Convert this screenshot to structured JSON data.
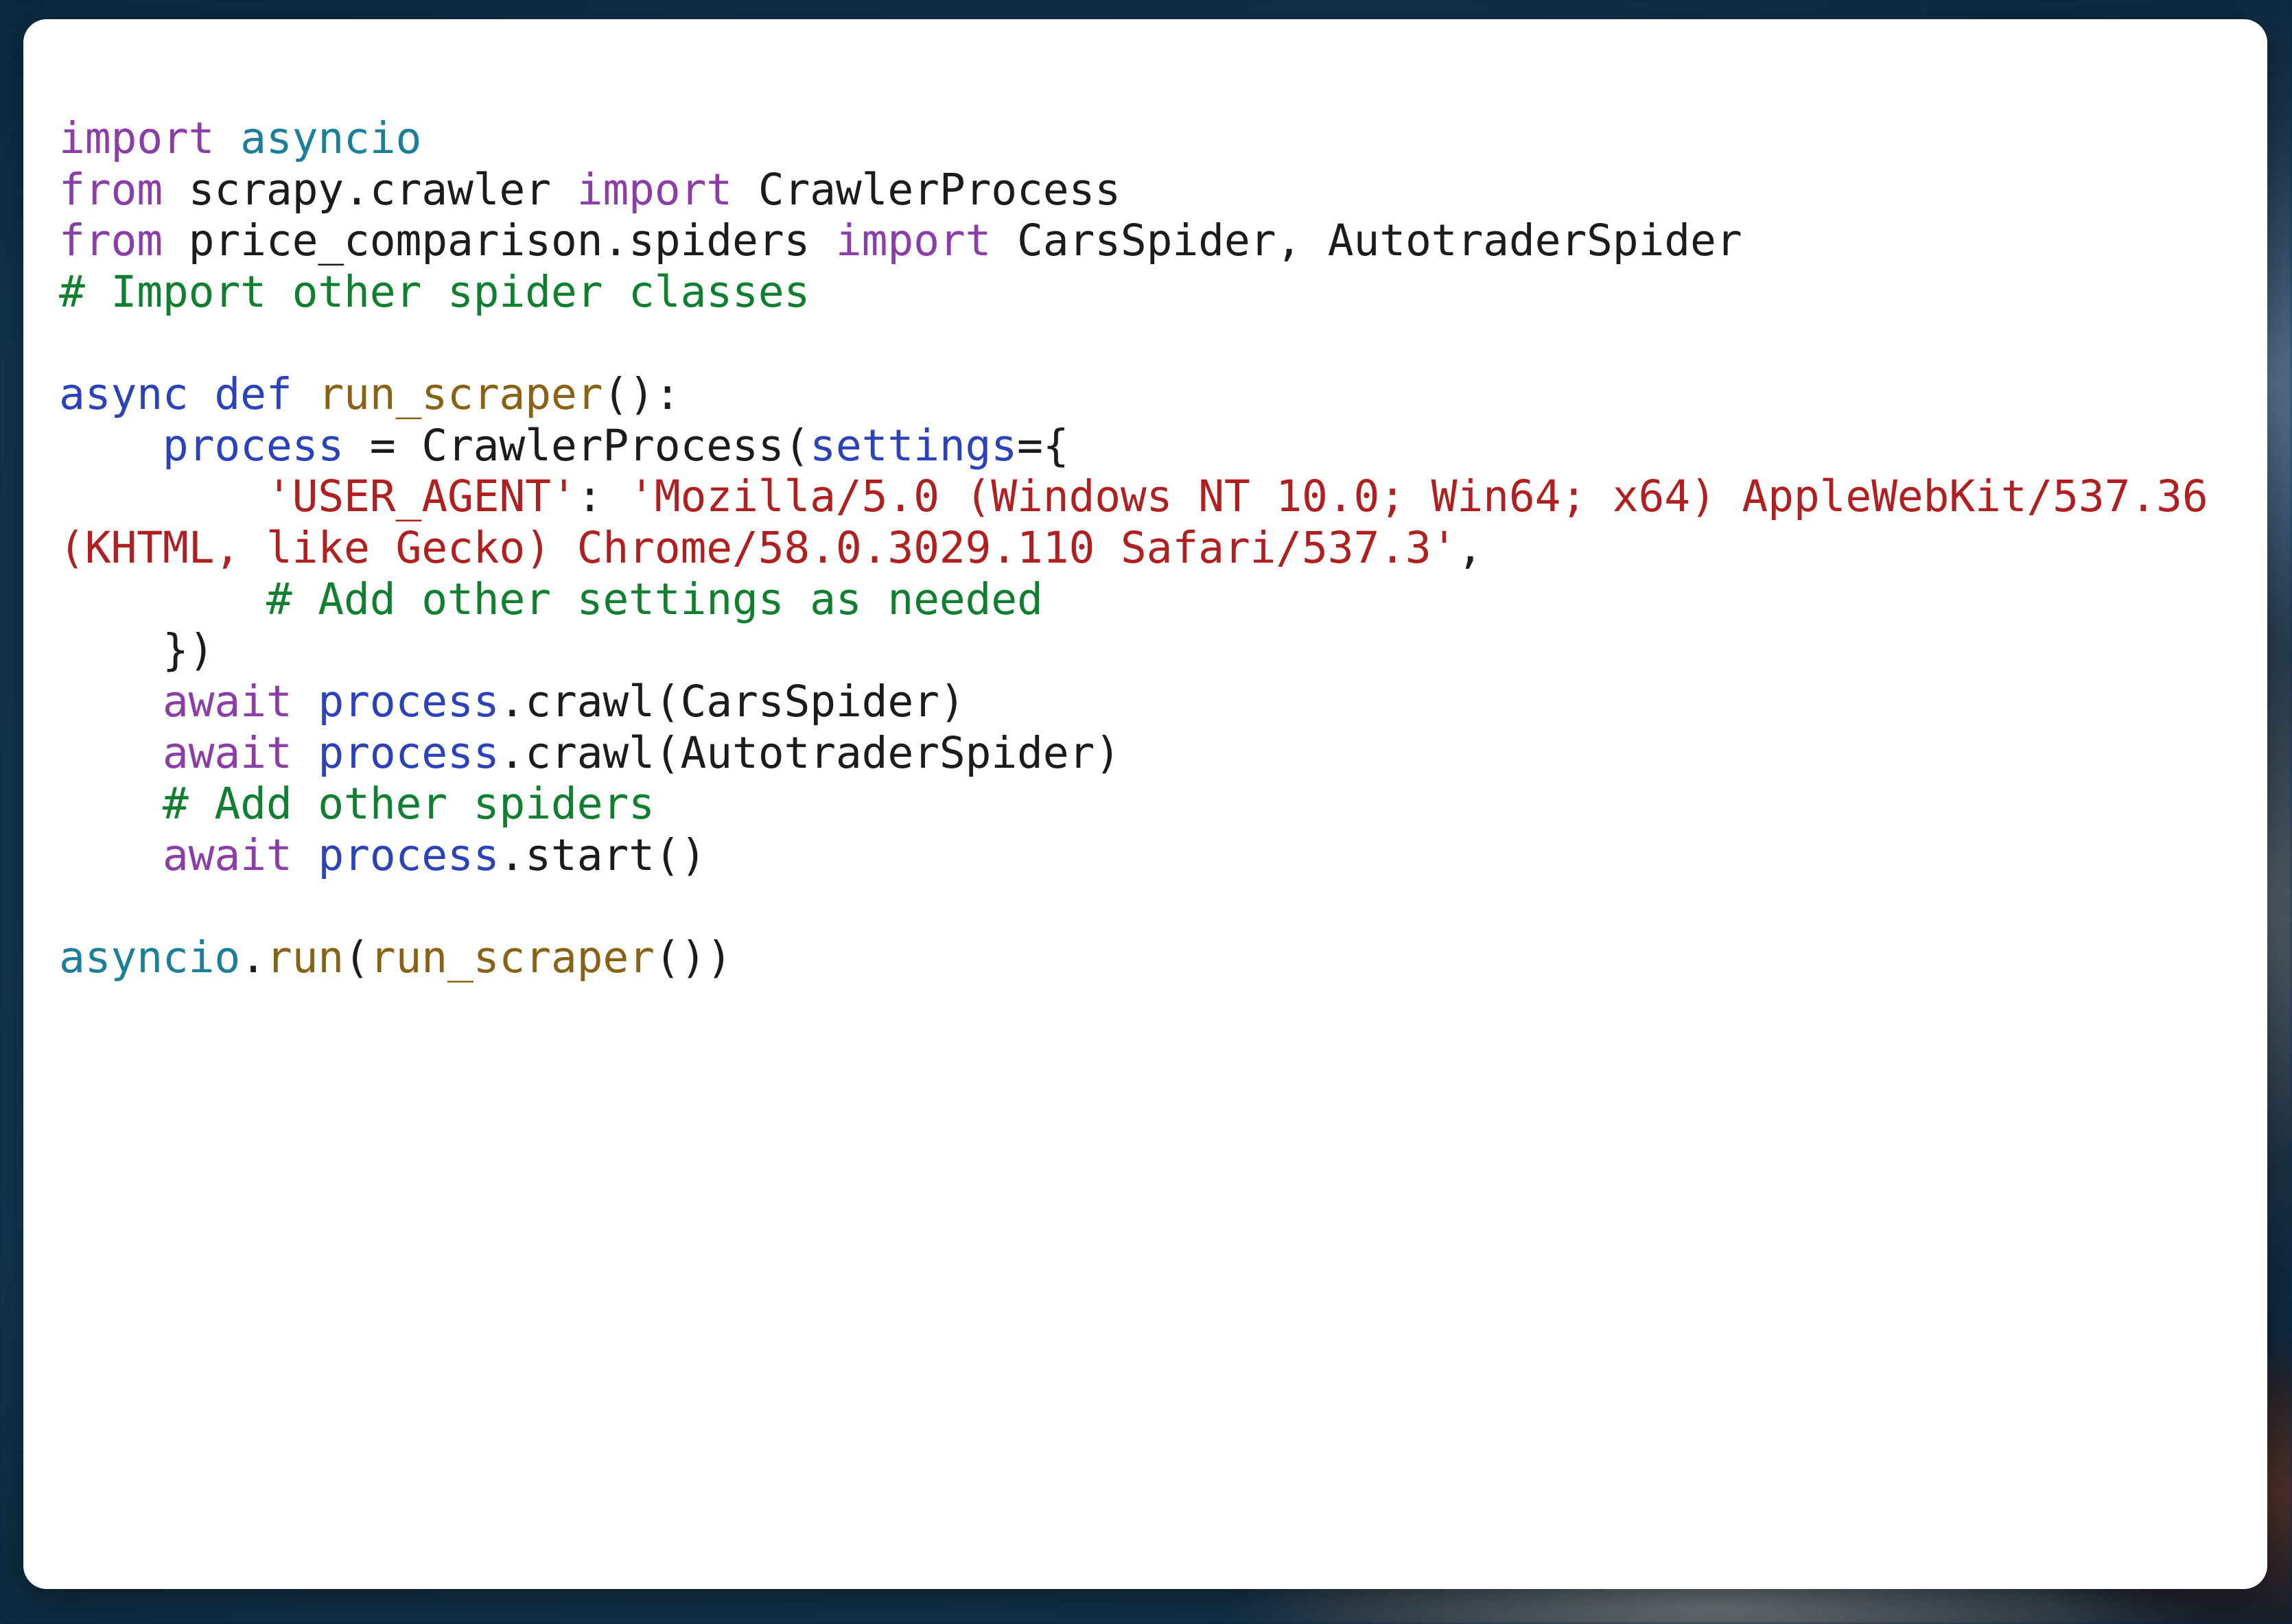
{
  "theme": {
    "page_background": "#0e3050",
    "card_background": "#ffffff",
    "keyword_color": "#8b3da8",
    "keyword_alt_color": "#2c42b8",
    "module_color": "#1b7f99",
    "function_color": "#8a6216",
    "variable_color": "#2c42b8",
    "string_color": "#b02020",
    "comment_color": "#108030",
    "plain_color": "#1c1c1c"
  },
  "code": {
    "language": "python",
    "lines": [
      {
        "id": "l01",
        "tokens": [
          {
            "t": "import",
            "c": "kw"
          },
          {
            "t": " ",
            "c": "pln"
          },
          {
            "t": "asyncio",
            "c": "mod"
          }
        ]
      },
      {
        "id": "l02",
        "tokens": [
          {
            "t": "from",
            "c": "kw"
          },
          {
            "t": " scrapy.crawler ",
            "c": "pln"
          },
          {
            "t": "import",
            "c": "kw"
          },
          {
            "t": " CrawlerProcess",
            "c": "pln"
          }
        ]
      },
      {
        "id": "l03",
        "tokens": [
          {
            "t": "from",
            "c": "kw"
          },
          {
            "t": " price_comparison.spiders ",
            "c": "pln"
          },
          {
            "t": "import",
            "c": "kw"
          },
          {
            "t": " CarsSpider, AutotraderSpider",
            "c": "pln"
          }
        ]
      },
      {
        "id": "l04",
        "tokens": [
          {
            "t": "# Import other spider classes",
            "c": "com"
          }
        ]
      },
      {
        "id": "l05",
        "blank": true,
        "tokens": []
      },
      {
        "id": "l06",
        "tokens": [
          {
            "t": "async def",
            "c": "kw2"
          },
          {
            "t": " ",
            "c": "pln"
          },
          {
            "t": "run_scraper",
            "c": "fn"
          },
          {
            "t": "():",
            "c": "pln"
          }
        ]
      },
      {
        "id": "l07",
        "tokens": [
          {
            "t": "    ",
            "c": "pln"
          },
          {
            "t": "process",
            "c": "var"
          },
          {
            "t": " = CrawlerProcess(",
            "c": "pln"
          },
          {
            "t": "settings",
            "c": "var"
          },
          {
            "t": "={",
            "c": "pln"
          }
        ]
      },
      {
        "id": "l08",
        "tokens": [
          {
            "t": "        ",
            "c": "pln"
          },
          {
            "t": "'USER_AGENT'",
            "c": "str"
          },
          {
            "t": ": ",
            "c": "pln"
          },
          {
            "t": "'Mozilla/5.0 (Windows NT 10.0; Win64; x64) AppleWebKit/537.36 (KHTML, like Gecko) Chrome/58.0.3029.110 Safari/537.3'",
            "c": "str"
          },
          {
            "t": ",",
            "c": "pln"
          }
        ]
      },
      {
        "id": "l09",
        "tokens": [
          {
            "t": "        ",
            "c": "pln"
          },
          {
            "t": "# Add other settings as needed",
            "c": "com"
          }
        ]
      },
      {
        "id": "l10",
        "tokens": [
          {
            "t": "    })",
            "c": "pln"
          }
        ]
      },
      {
        "id": "l11",
        "tokens": [
          {
            "t": "    ",
            "c": "pln"
          },
          {
            "t": "await",
            "c": "kw"
          },
          {
            "t": " ",
            "c": "pln"
          },
          {
            "t": "process",
            "c": "var"
          },
          {
            "t": ".crawl(CarsSpider)",
            "c": "pln"
          }
        ]
      },
      {
        "id": "l12",
        "tokens": [
          {
            "t": "    ",
            "c": "pln"
          },
          {
            "t": "await",
            "c": "kw"
          },
          {
            "t": " ",
            "c": "pln"
          },
          {
            "t": "process",
            "c": "var"
          },
          {
            "t": ".crawl(AutotraderSpider)",
            "c": "pln"
          }
        ]
      },
      {
        "id": "l13",
        "tokens": [
          {
            "t": "    ",
            "c": "pln"
          },
          {
            "t": "# Add other spiders",
            "c": "com"
          }
        ]
      },
      {
        "id": "l14",
        "tokens": [
          {
            "t": "    ",
            "c": "pln"
          },
          {
            "t": "await",
            "c": "kw"
          },
          {
            "t": " ",
            "c": "pln"
          },
          {
            "t": "process",
            "c": "var"
          },
          {
            "t": ".start()",
            "c": "pln"
          }
        ]
      },
      {
        "id": "l15",
        "blank": true,
        "tokens": []
      },
      {
        "id": "l16",
        "tokens": [
          {
            "t": "asyncio",
            "c": "mod"
          },
          {
            "t": ".",
            "c": "pln"
          },
          {
            "t": "run",
            "c": "fn"
          },
          {
            "t": "(",
            "c": "pln"
          },
          {
            "t": "run_scraper",
            "c": "fn"
          },
          {
            "t": "())",
            "c": "pln"
          }
        ]
      }
    ],
    "plain_text": "import asyncio\nfrom scrapy.crawler import CrawlerProcess\nfrom price_comparison.spiders import CarsSpider, AutotraderSpider\n# Import other spider classes\n\nasync def run_scraper():\n    process = CrawlerProcess(settings={\n        'USER_AGENT': 'Mozilla/5.0 (Windows NT 10.0; Win64; x64) AppleWebKit/537.36 (KHTML, like Gecko) Chrome/58.0.3029.110 Safari/537.3',\n        # Add other settings as needed\n    })\n    await process.crawl(CarsSpider)\n    await process.crawl(AutotraderSpider)\n    # Add other spiders\n    await process.start()\n\nasyncio.run(run_scraper())"
  }
}
